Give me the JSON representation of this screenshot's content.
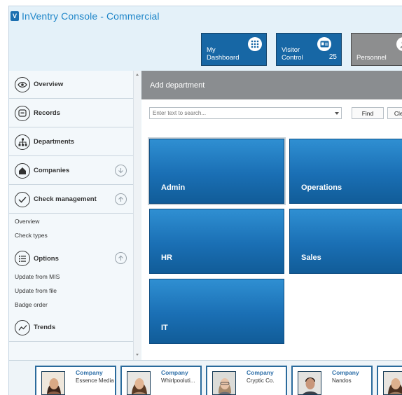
{
  "app": {
    "title": "InVentry Console - Commercial",
    "logo_letter": "V"
  },
  "header_tiles": [
    {
      "label_line1": "My",
      "label_line2": "Dashboard",
      "count": "",
      "icon": "grid-icon"
    },
    {
      "label_line1": "Visitor",
      "label_line2": "Control",
      "count": "25",
      "icon": "visitor-card-icon"
    },
    {
      "label_line1": "",
      "label_line2": "Personnel",
      "count": "",
      "icon": "person-icon"
    }
  ],
  "sidebar": {
    "items": [
      {
        "label": "Overview",
        "icon": "eye-icon"
      },
      {
        "label": "Records",
        "icon": "records-icon"
      },
      {
        "label": "Departments",
        "icon": "hierarchy-icon"
      },
      {
        "label": "Companies",
        "icon": "building-icon",
        "chevron": "down"
      },
      {
        "label": "Check management",
        "icon": "check-icon",
        "chevron": "up"
      },
      {
        "label": "Options",
        "icon": "list-icon",
        "chevron": "up"
      },
      {
        "label": "Trends",
        "icon": "trend-icon"
      }
    ],
    "check_management_sub": [
      "Overview",
      "Check types"
    ],
    "options_sub": [
      "Update from MIS",
      "Update from file",
      "Badge order"
    ]
  },
  "main": {
    "section_title": "Add department",
    "search": {
      "placeholder": "Enter text to search...",
      "value": ""
    },
    "find_label": "Find",
    "clear_label": "Clear",
    "departments": [
      "Admin",
      "Operations",
      "HR",
      "Sales",
      "IT"
    ]
  },
  "footer": {
    "companies": [
      {
        "title": "Company",
        "name": "Essence Media"
      },
      {
        "title": "Company",
        "name": "Whirlpooluti..."
      },
      {
        "title": "Company",
        "name": "Cryptic Co."
      },
      {
        "title": "Company",
        "name": "Nandos"
      },
      {
        "title": "",
        "name": ""
      }
    ]
  },
  "colors": {
    "accent_blue": "#1767a5",
    "tile_gray": "#8d8e8f",
    "header_bar_gray": "#8a8d90",
    "title_blue": "#1f86c9"
  }
}
